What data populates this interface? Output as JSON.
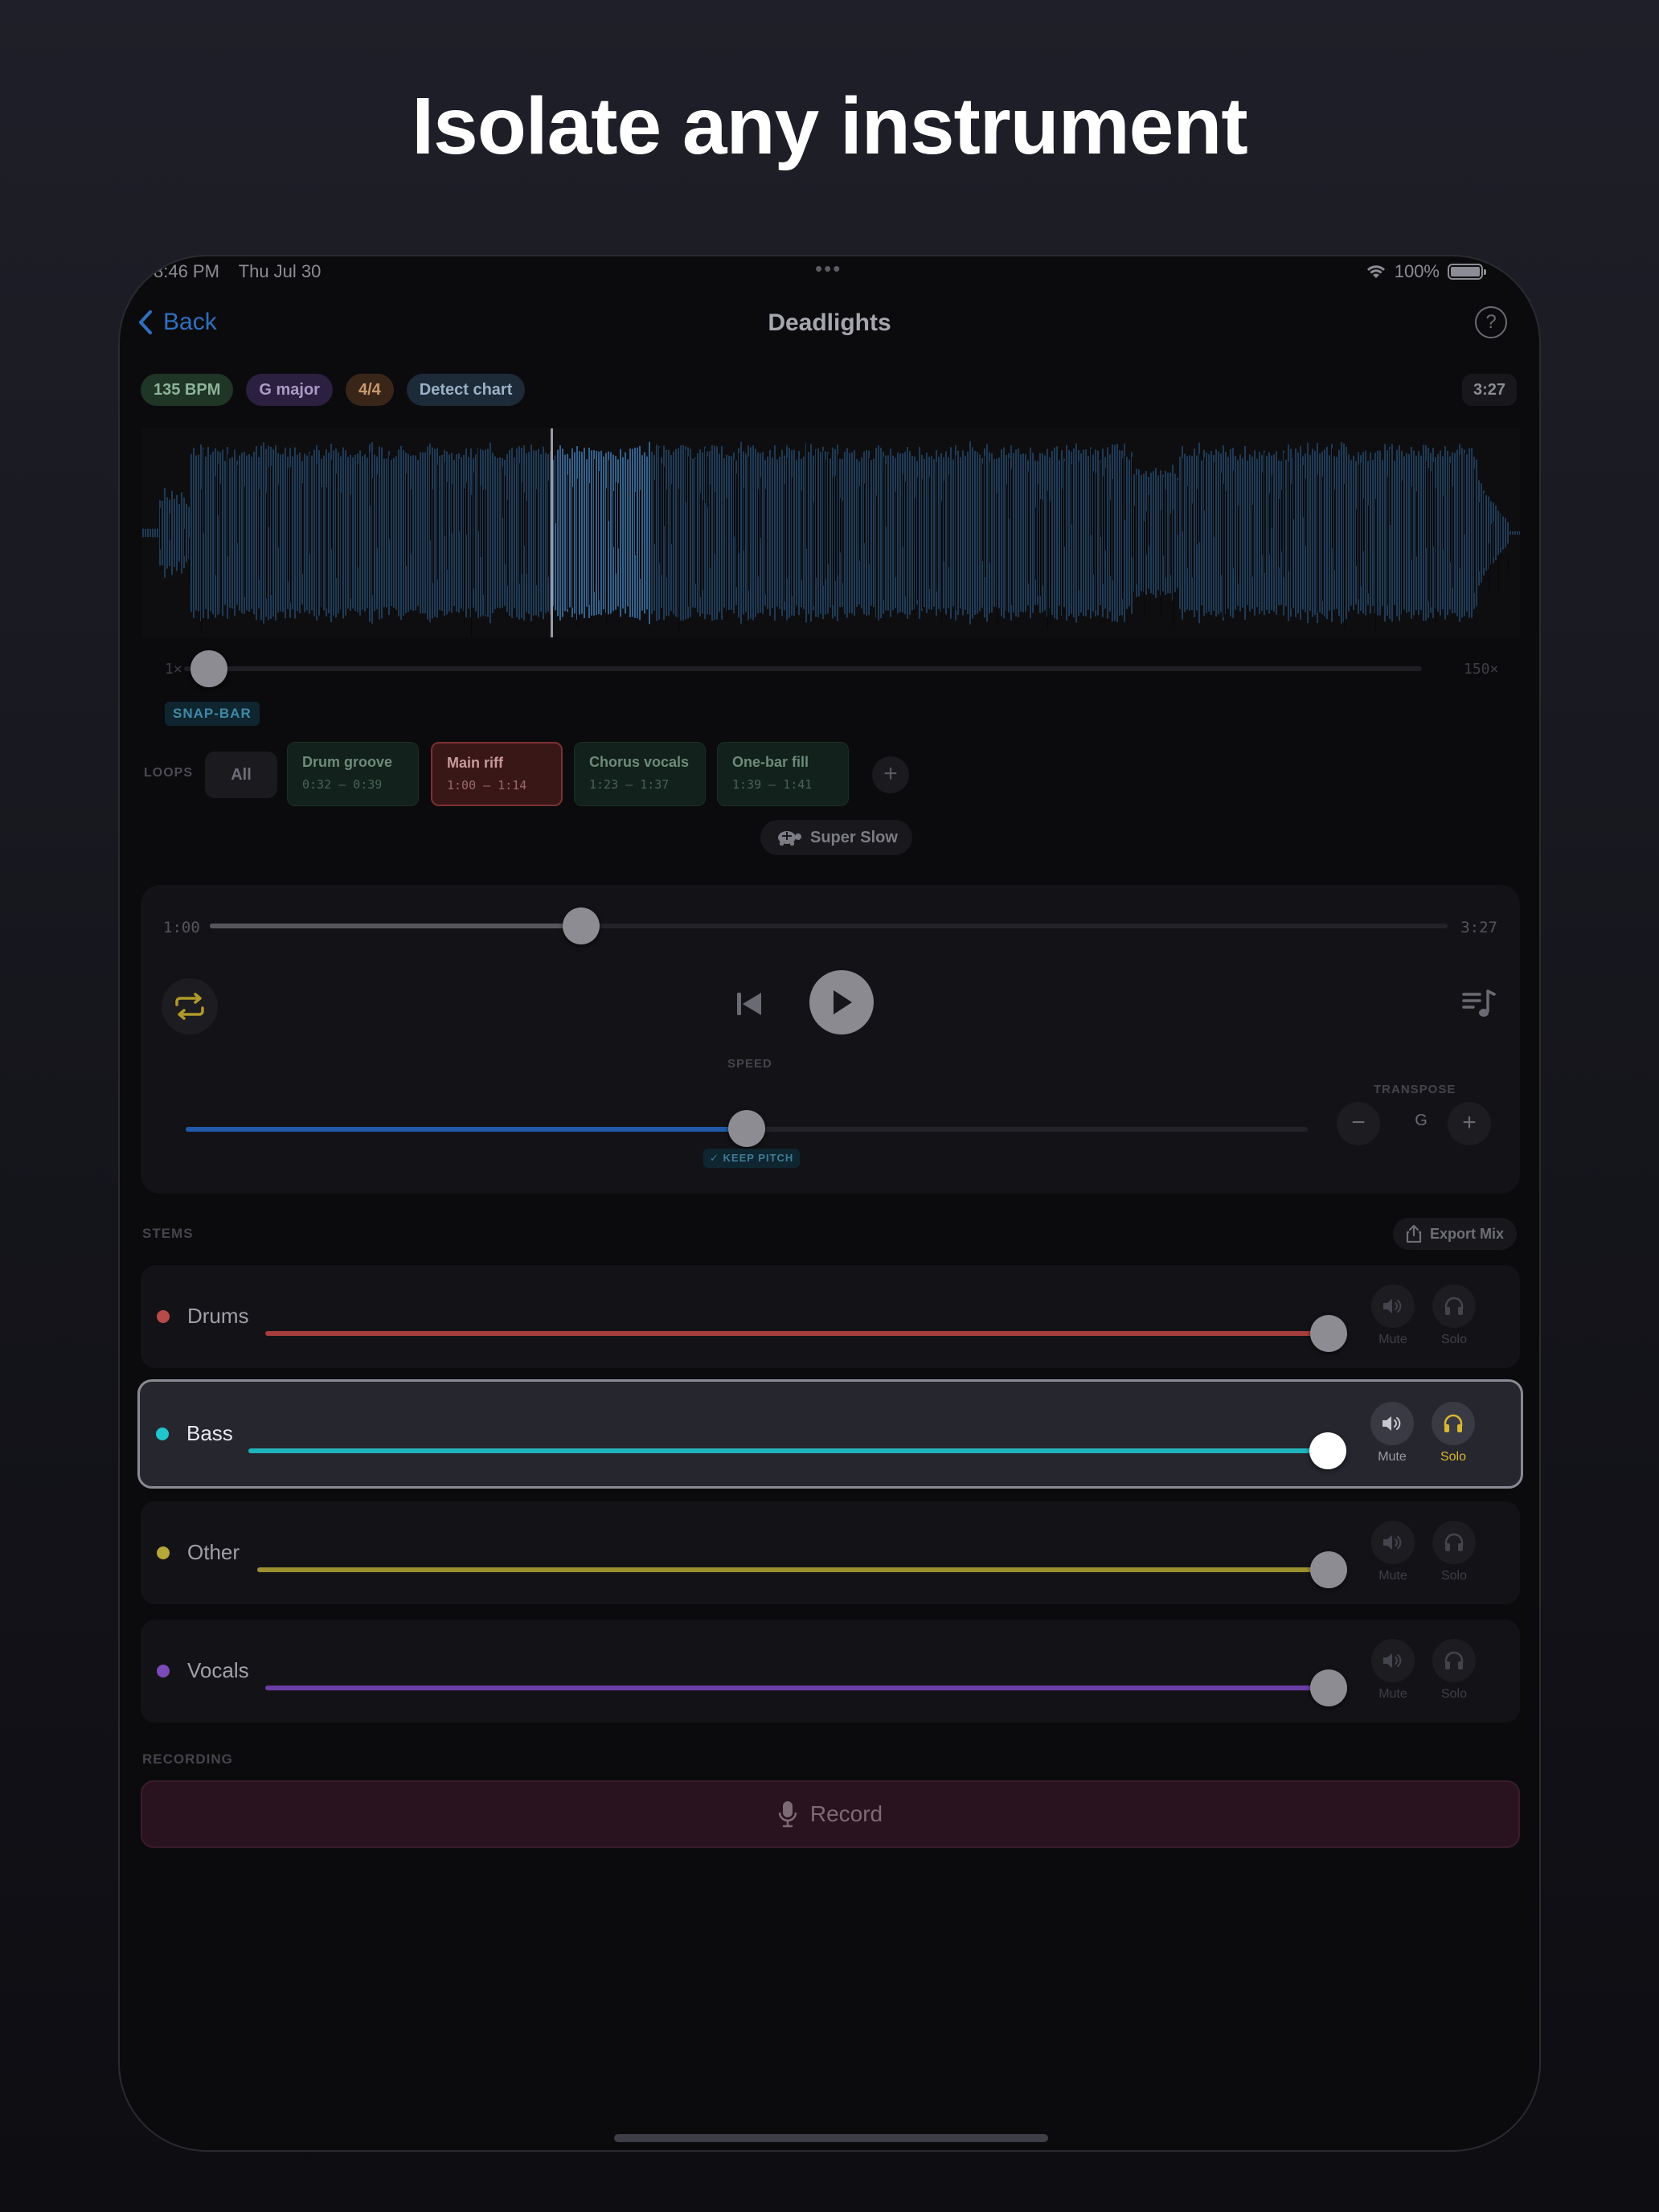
{
  "headline": "Isolate any instrument",
  "status_bar": {
    "time": "8:46 PM",
    "date": "Thu Jul 30",
    "battery": "100%"
  },
  "nav": {
    "back_label": "Back",
    "title": "Deadlights",
    "help_symbol": "?"
  },
  "chips": {
    "bpm": "135 BPM",
    "key": "G major",
    "time_signature": "4/4",
    "detect": "Detect chart"
  },
  "duration": "3:27",
  "zoom": {
    "min_label": "1×",
    "max_label": "150×"
  },
  "snap_label": "SNAP-BAR",
  "loops": {
    "label": "LOOPS",
    "all_label": "All",
    "items": [
      {
        "name": "Drum groove",
        "range": "0:32 – 0:39"
      },
      {
        "name": "Main riff",
        "range": "1:00 – 1:14"
      },
      {
        "name": "Chorus vocals",
        "range": "1:23 – 1:37"
      },
      {
        "name": "One-bar fill",
        "range": "1:39 – 1:41"
      }
    ],
    "add_symbol": "+"
  },
  "super_slow_label": "Super Slow",
  "player": {
    "start_time": "1:00",
    "end_time": "3:27",
    "position_fraction": 0.3,
    "speed_label": "SPEED",
    "speed_fraction": 0.5,
    "keep_pitch_label": "✓ KEEP PITCH",
    "transpose_label": "TRANSPOSE",
    "transpose_key": "G",
    "minus_symbol": "−",
    "plus_symbol": "+"
  },
  "stems": {
    "label": "STEMS",
    "export_label": "Export Mix",
    "mute_label": "Mute",
    "solo_label": "Solo",
    "items": [
      {
        "name": "Drums",
        "color": "#b84a4a",
        "track_color": "#a53d3d",
        "volume": 1.0,
        "active": false
      },
      {
        "name": "Bass",
        "color": "#1fc4cc",
        "track_color": "#1fb4bc",
        "volume": 1.0,
        "active": true
      },
      {
        "name": "Other",
        "color": "#b5a73a",
        "track_color": "#9c9030",
        "volume": 1.0,
        "active": false
      },
      {
        "name": "Vocals",
        "color": "#7a4ab8",
        "track_color": "#6a3ea6",
        "volume": 1.0,
        "active": false
      }
    ]
  },
  "recording": {
    "label": "RECORDING",
    "record_label": "Record"
  },
  "colors": {
    "accent_blue": "#2f6fbf",
    "speed_fill": "#1f5aa8",
    "solo_yellow": "#d8b830",
    "waveform": "#1f3a55",
    "waveform_selected": "#34608a"
  }
}
